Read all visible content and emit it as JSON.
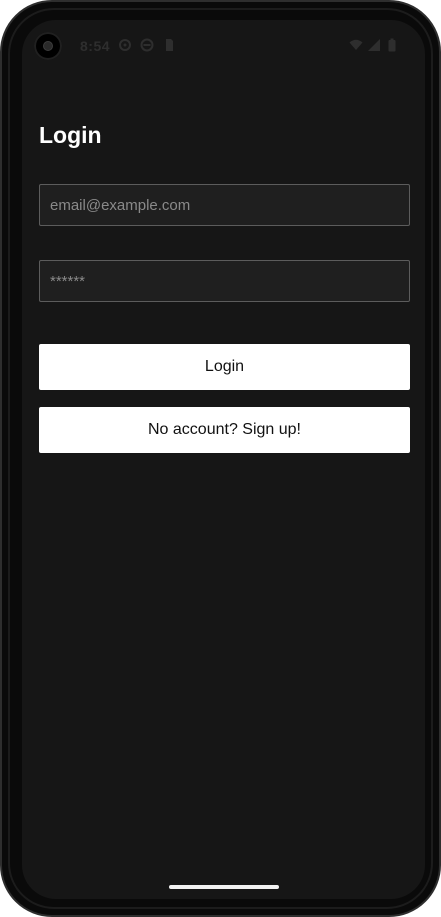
{
  "status_bar": {
    "time": "8:54",
    "icons_left": [
      "gear-icon",
      "sync-icon",
      "sim-card-icon"
    ],
    "icons_right": [
      "wifi-icon",
      "signal-icon",
      "battery-icon"
    ]
  },
  "login": {
    "title": "Login",
    "email_placeholder": "email@example.com",
    "password_placeholder": "******",
    "login_label": "Login",
    "signup_label": "No account? Sign up!"
  },
  "colors": {
    "background": "#161616",
    "input_background": "#1f1f1f",
    "input_border": "#5c5c5c",
    "button_background": "#ffffff",
    "button_text": "#111111",
    "title_text": "#ffffff"
  }
}
